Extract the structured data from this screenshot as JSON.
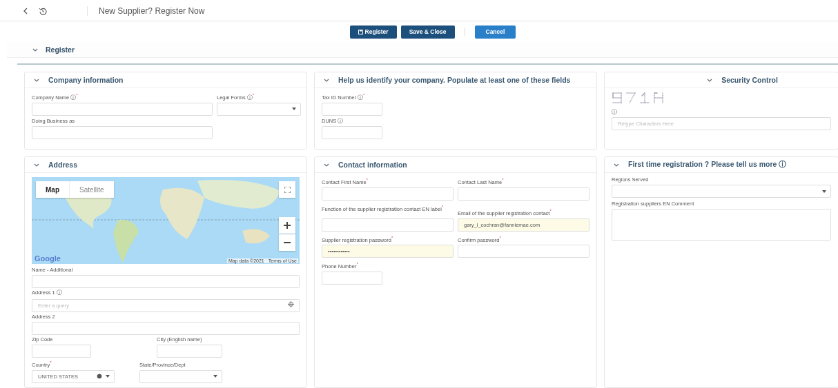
{
  "header": {
    "title": "New Supplier? Register Now"
  },
  "toolbar": {
    "buttons": [
      {
        "label": "Register",
        "kind": "save"
      },
      {
        "label": "Save & Close",
        "kind": "primary"
      },
      {
        "label": "Cancel",
        "kind": "secondary"
      }
    ]
  },
  "section": {
    "title": "Register",
    "expanded": true
  },
  "panels": [
    {
      "title": "Company information",
      "expanded": true,
      "fields": [
        {
          "label": "Company Name ⓘ$^{*}$",
          "kind": "text"
        },
        {
          "label": "Legal Forms ⓘ$^{*}$",
          "kind": "select"
        },
        {
          "label": "Doing Business as",
          "kind": "text"
        }
      ]
    },
    {
      "title": "Help us identify your company. Populate at least one of these fields",
      "expanded": true,
      "fields": [
        {
          "label": "Tax ID Number ⓘ$^{*}$",
          "kind": "text"
        },
        {
          "label": "DUNS ⓘ",
          "kind": "text"
        }
      ]
    },
    {
      "title": "Security Control",
      "expanded": true,
      "kind": "captcha",
      "fields": [
        {
          "label": "ⓘ",
          "kind": "text",
          "placeholder": "Retype Characters Here"
        }
      ]
    },
    {
      "title": "Address",
      "expanded": true,
      "map": {
        "types": [
          {
            "label": "Map",
            "selected": true
          },
          {
            "label": "Satellite",
            "selected": false
          }
        ],
        "logo": "Google",
        "attribution": "Map data ©2021",
        "terms": "Terms of Use"
      },
      "fields": [
        {
          "label": "Name - Additional",
          "kind": "text"
        },
        {
          "label": "Address 1 ⓘ",
          "kind": "search",
          "placeholder": "Enter a query"
        },
        {
          "label": "Address 2",
          "kind": "text"
        },
        {
          "label": "Zip Code",
          "kind": "text"
        },
        {
          "label": "City (English name)",
          "kind": "text"
        },
        {
          "label": "Country$^{*}$",
          "kind": "country",
          "value": "UNITED STATES"
        },
        {
          "label": "State/Province/Dept",
          "kind": "select"
        }
      ]
    },
    {
      "title": "Contact information",
      "expanded": true,
      "fields": [
        {
          "label": "Contact First Name$^{*}$",
          "kind": "text"
        },
        {
          "label": "Contact Last Name$^{*}$",
          "kind": "text"
        },
        {
          "label": "Function of the supplier registration contact EN label$^{*}$",
          "kind": "text"
        },
        {
          "label": "Email of the supplier registration contact$^{*}$",
          "kind": "text",
          "value": "gary_l_cochran@fanniemae.com",
          "autofilled": true
        },
        {
          "label": "Supplier registration password$^{*}$",
          "kind": "password",
          "value": "••••••••••••",
          "autofilled": true
        },
        {
          "label": "Confirm password$^{*}$",
          "kind": "password"
        },
        {
          "label": "Phone Number$^{*}$",
          "kind": "text"
        }
      ]
    },
    {
      "title": "First time registration ? Please tell us more ⓘ",
      "expanded": true,
      "fields": [
        {
          "label": "Regions Served",
          "kind": "select"
        },
        {
          "label": "Registration suppliers EN Comment",
          "kind": "textarea"
        }
      ]
    }
  ]
}
